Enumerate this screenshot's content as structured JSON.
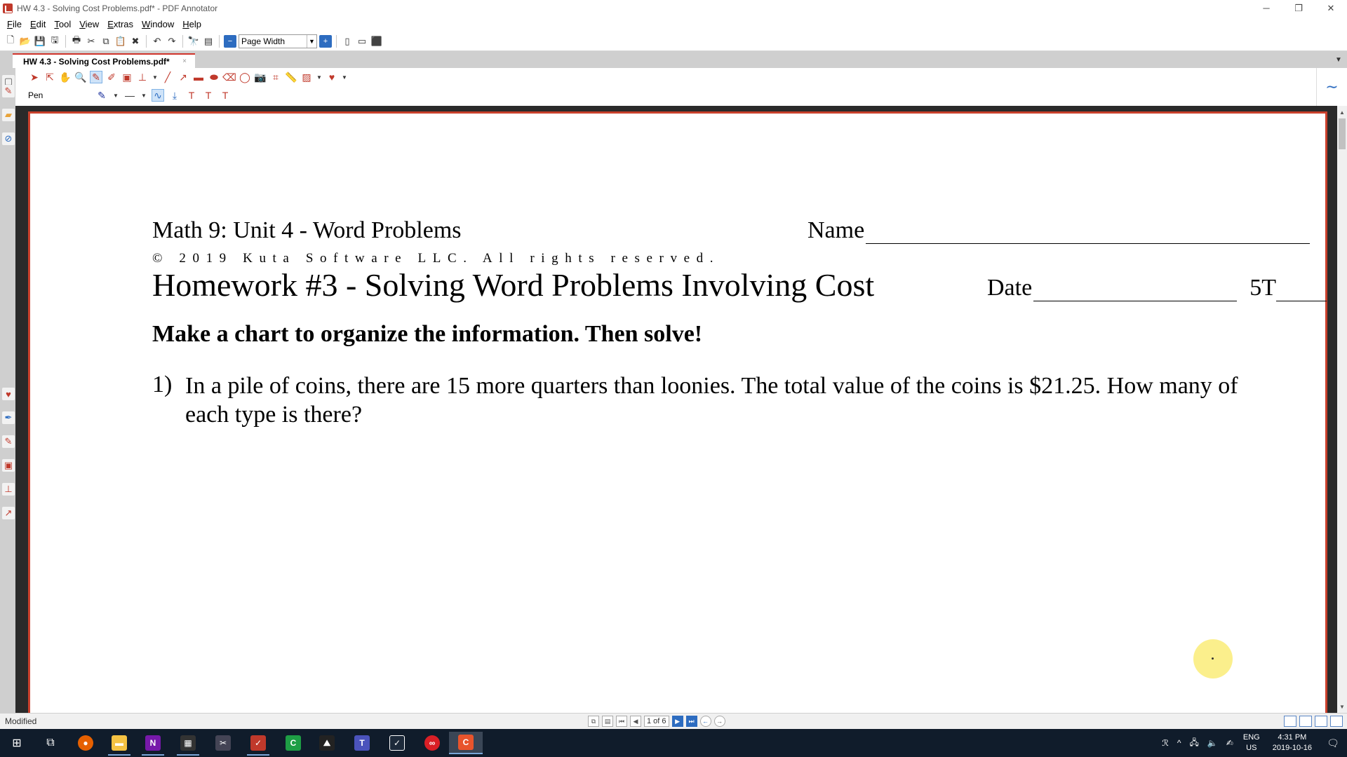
{
  "window": {
    "title": "HW 4.3 - Solving Cost Problems.pdf* - PDF Annotator",
    "controls": [
      "─",
      "❐",
      "✕"
    ]
  },
  "menu": [
    "File",
    "Edit",
    "Tool",
    "View",
    "Extras",
    "Window",
    "Help"
  ],
  "toolbar": {
    "zoom_select": "Page Width"
  },
  "tab": {
    "label": "HW 4.3 - Solving Cost Problems.pdf*",
    "close": "×"
  },
  "anno_toolbar": {
    "active_tool_label": "Pen",
    "text_tools": [
      "T",
      "T",
      "T"
    ]
  },
  "document": {
    "unit_title": "Math 9: Unit 4 - Word Problems",
    "name_label": "Name",
    "copyright": "© 2019 Kuta Software LLC. All rights reserved.",
    "homework_title": "Homework #3 - Solving Word Problems Involving Cost",
    "date_label": "Date",
    "class_label": "5T",
    "instruction": "Make a chart to organize the information. Then solve!",
    "question_number": "1)",
    "question_text": "In a pile of coins, there are 15 more quarters than loonies. The total value of the coins is $21.25. How many of each type is there?"
  },
  "status": {
    "left": "Modified",
    "page_indicator": "1 of 6"
  },
  "taskbar": {
    "input_lang_1": "ENG",
    "input_lang_2": "US",
    "time": "4:31 PM",
    "date": "2019-10-16"
  },
  "colors": {
    "accent_red": "#c0392b",
    "accent_blue": "#2d6cc0",
    "highlight_yellow": "#faec78",
    "taskbar_bg": "#101c2b"
  }
}
